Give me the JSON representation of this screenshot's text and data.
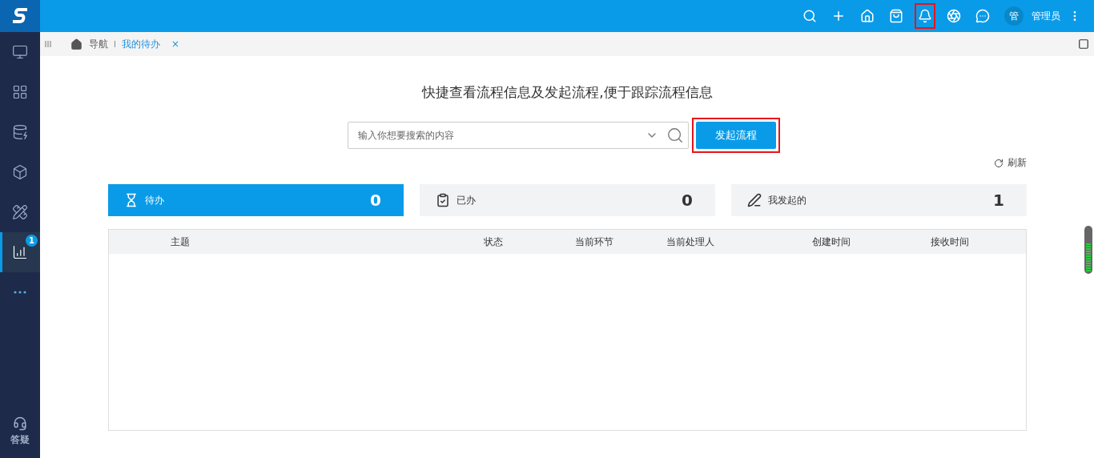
{
  "top_bar": {
    "actions": [
      {
        "kind": "search",
        "highlighted": false
      },
      {
        "kind": "add",
        "highlighted": false
      },
      {
        "kind": "home",
        "highlighted": false
      },
      {
        "kind": "bag",
        "highlighted": false
      },
      {
        "kind": "bell",
        "highlighted": true
      },
      {
        "kind": "hub",
        "highlighted": false
      },
      {
        "kind": "chat",
        "highlighted": false
      }
    ],
    "avatar": "管",
    "user": "管理员"
  },
  "sidebar": {
    "items": [
      {
        "kind": "monitor",
        "selected": false
      },
      {
        "kind": "apps",
        "selected": false
      },
      {
        "kind": "database",
        "selected": false
      },
      {
        "kind": "cube",
        "selected": false
      },
      {
        "kind": "tool",
        "selected": false
      },
      {
        "kind": "chart",
        "selected": true,
        "badge": "1"
      },
      {
        "kind": "more",
        "selected": false
      }
    ],
    "help": "答疑"
  },
  "breadcrumb": {
    "home": "导航",
    "tabs": [
      {
        "label": "我的待办",
        "selected": true,
        "close": "×"
      }
    ]
  },
  "heading": "快捷查看流程信息及发起流程,便于跟踪流程信息",
  "search": {
    "placeholder": "输入你想要搜索的内容"
  },
  "start_button": {
    "label": "发起流程",
    "highlighted": true
  },
  "refresh": "刷新",
  "stats": [
    {
      "kind": "pending",
      "label": "待办",
      "count": "0",
      "selected": true
    },
    {
      "kind": "done",
      "label": "已办",
      "count": "0",
      "selected": false
    },
    {
      "kind": "mine",
      "label": "我发起的",
      "count": "1",
      "selected": false
    }
  ],
  "table": {
    "columns": [
      "主题",
      "状态",
      "当前环节",
      "当前处理人",
      "创建时间",
      "接收时间"
    ]
  }
}
